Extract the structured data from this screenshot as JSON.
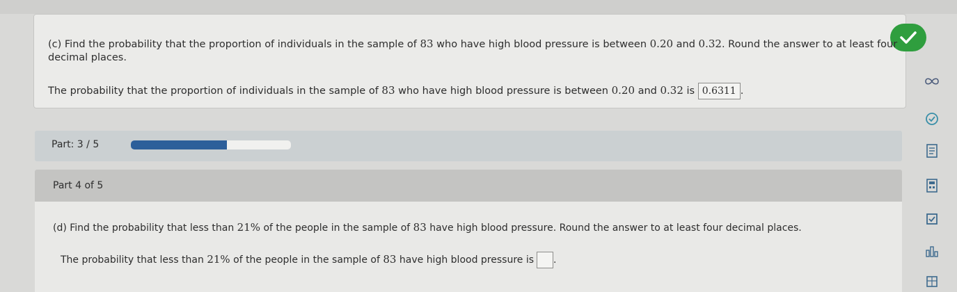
{
  "part_c": {
    "question_line1": "(c) Find the probability that the proportion of individuals in the sample of ",
    "sample_size": "83",
    "question_line1b": " who have high blood pressure is between ",
    "low": "0.20",
    "and_word": " and ",
    "high": "0.32",
    "question_line1c": ". Round the answer to at least four decimal places.",
    "answer_prefix": "The probability that the proportion of individuals in the sample of ",
    "answer_mid": " who have high blood pressure is between ",
    "answer_is": " is ",
    "answer_value": "0.6311",
    "answer_suffix": "."
  },
  "progress": {
    "label": "Part: 3 / 5",
    "fraction": 0.6
  },
  "part_d_header": {
    "label": "Part 4 of 5"
  },
  "part_d": {
    "question_a": "(d) Find the probability that less than ",
    "percent": "21%",
    "question_b": " of the people in the sample of ",
    "sample_size": "83",
    "question_c": " have high blood pressure. Round the answer to at least four decimal places.",
    "answer_a": "The probability that less than ",
    "answer_b": " of the people in the sample of ",
    "answer_c": " have high blood pressure is",
    "answer_suffix": "."
  },
  "side_icons": [
    "infinity-icon",
    "refresh-icon",
    "textbook-icon",
    "calculator-icon",
    "checkbox-icon",
    "stats-icon",
    "table-icon"
  ],
  "colors": {
    "check_green": "#2f9e3e",
    "progress_blue": "#2d5f9a"
  }
}
